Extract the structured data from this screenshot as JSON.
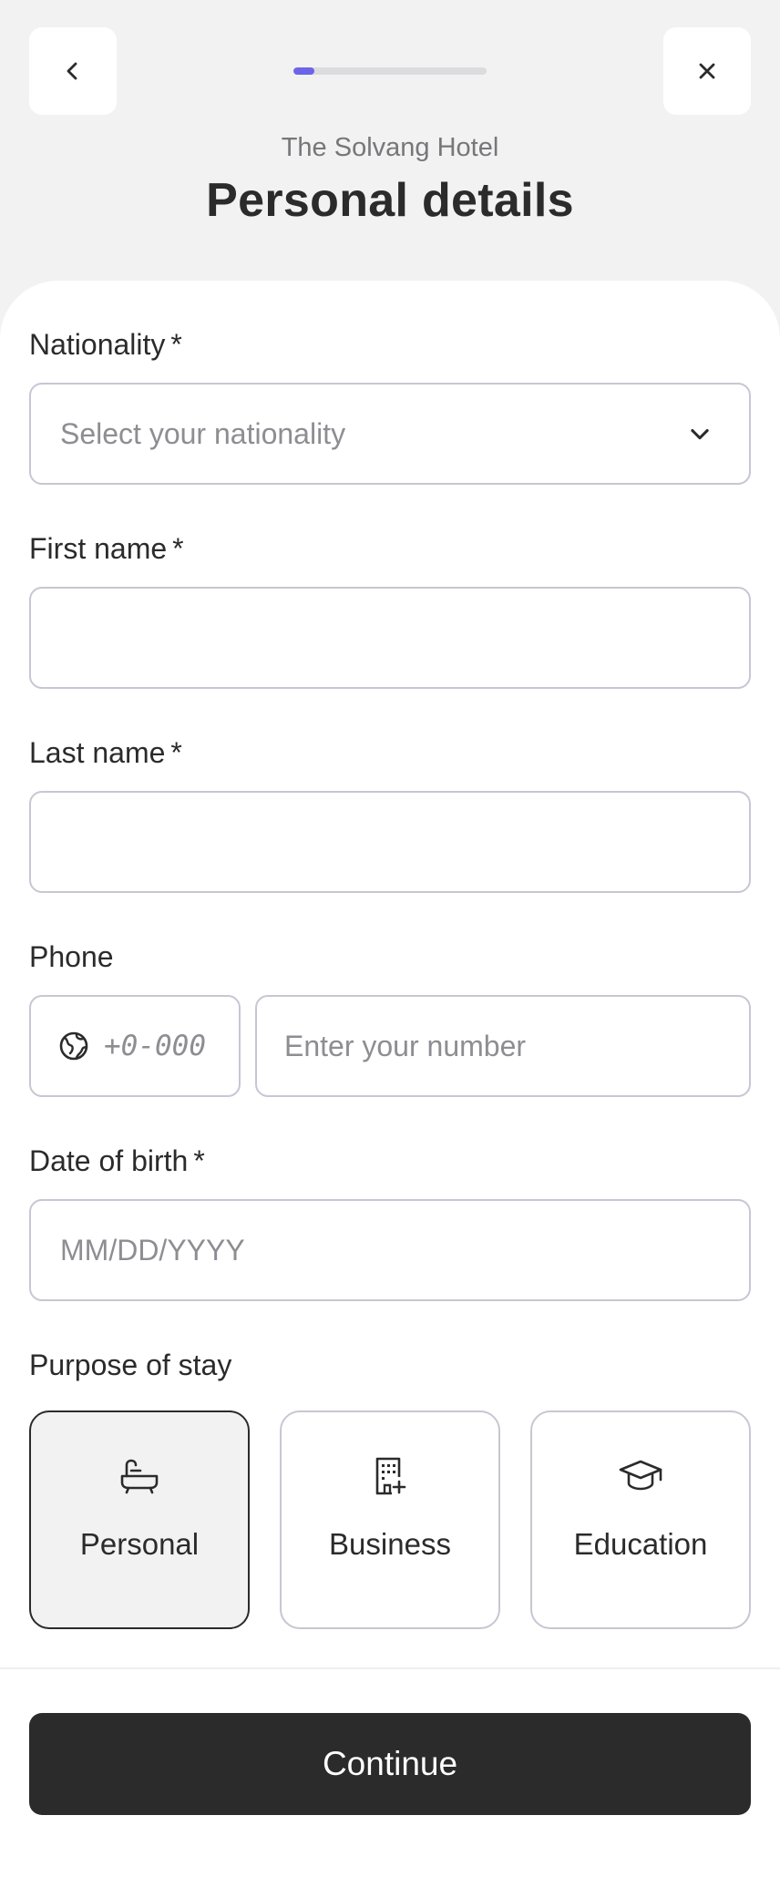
{
  "header": {
    "hotel_name": "The Solvang Hotel",
    "title": "Personal details",
    "progress_fraction": 0.11,
    "back_icon": "chevron-left-icon",
    "close_icon": "close-icon"
  },
  "form": {
    "nationality": {
      "label": "Nationality",
      "required_mark": "*",
      "placeholder": "Select your nationality",
      "icon": "chevron-down-icon"
    },
    "first_name": {
      "label": "First name",
      "required_mark": "*",
      "value": ""
    },
    "last_name": {
      "label": "Last name",
      "required_mark": "*",
      "value": ""
    },
    "phone": {
      "label": "Phone",
      "code_placeholder": "+0-000",
      "number_placeholder": "Enter your number",
      "code_icon": "globe-icon"
    },
    "dob": {
      "label": "Date of birth",
      "required_mark": "*",
      "placeholder": "MM/DD/YYYY"
    },
    "purpose": {
      "label": "Purpose of stay",
      "options": [
        {
          "label": "Personal",
          "icon": "bathtub-icon",
          "selected": true
        },
        {
          "label": "Business",
          "icon": "office-building-icon",
          "selected": false
        },
        {
          "label": "Education",
          "icon": "graduation-cap-icon",
          "selected": false
        }
      ]
    }
  },
  "footer": {
    "continue_label": "Continue"
  },
  "colors": {
    "accent": "#6e64e8",
    "primary_button": "#2b2b2b",
    "input_border": "#c8c6d4",
    "background": "#f2f2f2"
  }
}
